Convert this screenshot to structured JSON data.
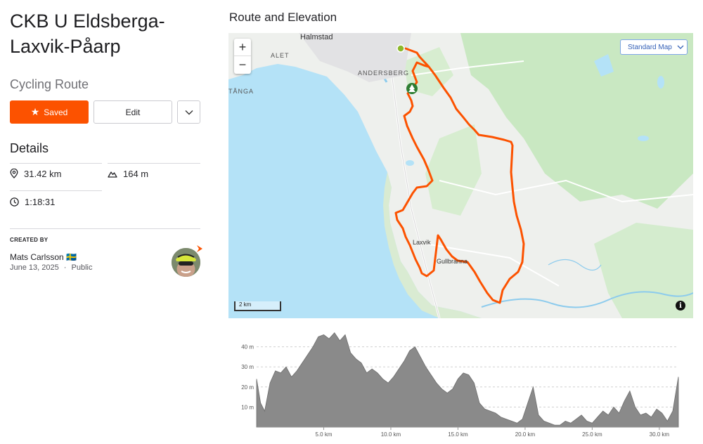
{
  "route": {
    "title": "CKB U Eldsberga-Laxvik-Påarp",
    "type": "Cycling Route"
  },
  "buttons": {
    "saved_label": "Saved",
    "edit_label": "Edit"
  },
  "details": {
    "heading": "Details",
    "distance": "31.42 km",
    "elevation_gain": "164 m",
    "duration": "1:18:31"
  },
  "creator": {
    "heading": "CREATED BY",
    "name": "Mats Carlsson 🇸🇪",
    "date": "June 13, 2025",
    "separator": "·",
    "visibility": "Public"
  },
  "map": {
    "section_title": "Route and Elevation",
    "zoom_in": "+",
    "zoom_out": "−",
    "style_select": "Standard Map",
    "scale_label": "2 km",
    "info": "i",
    "labels": {
      "city": "Halmstad",
      "alet": "ALET",
      "andersberg": "ANDERSBERG",
      "tanga": "TÅNGA",
      "laxvik": "Laxvik",
      "gullbranna": "Gullbranna"
    }
  },
  "colors": {
    "accent": "#fc5200",
    "route": "#fc5200",
    "water": "#b4e2f7",
    "land": "#eef0ed",
    "forest": "#c9e8c2",
    "start_marker": "#8cb82b",
    "poi_marker": "#2e7d32",
    "elevation_fill": "#8a8a8a"
  },
  "chart_data": {
    "type": "area",
    "title": "",
    "xlabel": "",
    "ylabel": "",
    "xlim": [
      0,
      31.42
    ],
    "ylim": [
      0,
      50
    ],
    "x_ticks": [
      "5.0 km",
      "10.0 km",
      "15.0 km",
      "20.0 km",
      "25.0 km",
      "30.0 km"
    ],
    "y_ticks": [
      "10 m",
      "20 m",
      "30 m",
      "40 m"
    ],
    "y_tick_values": [
      10,
      20,
      30,
      40
    ],
    "x_tick_values": [
      5,
      10,
      15,
      20,
      25,
      30
    ],
    "grid": true,
    "series": [
      {
        "x": [
          0,
          0.3,
          0.6,
          1.0,
          1.4,
          1.8,
          2.2,
          2.6,
          3.0,
          3.4,
          3.8,
          4.2,
          4.6,
          5.0,
          5.4,
          5.8,
          6.2,
          6.6,
          7.0,
          7.4,
          7.8,
          8.2,
          8.6,
          9.0,
          9.4,
          9.8,
          10.2,
          10.6,
          11.0,
          11.4,
          11.8,
          12.2,
          12.6,
          13.0,
          13.4,
          13.8,
          14.2,
          14.6,
          15.0,
          15.4,
          15.8,
          16.2,
          16.6,
          17.0,
          17.4,
          17.8,
          18.2,
          18.6,
          19.0,
          19.4,
          19.8,
          20.2,
          20.6,
          21.0,
          21.4,
          21.8,
          22.2,
          22.6,
          23.0,
          23.4,
          23.8,
          24.2,
          24.6,
          25.0,
          25.4,
          25.8,
          26.2,
          26.6,
          27.0,
          27.4,
          27.8,
          28.2,
          28.6,
          29.0,
          29.4,
          29.8,
          30.2,
          30.6,
          31.0,
          31.42
        ],
        "y": [
          24,
          12,
          8,
          22,
          28,
          27,
          30,
          25,
          28,
          32,
          36,
          40,
          45,
          46,
          44,
          47,
          43,
          46,
          37,
          34,
          32,
          27,
          29,
          27,
          24,
          22,
          25,
          29,
          33,
          38,
          40,
          35,
          30,
          26,
          22,
          19,
          17,
          19,
          24,
          27,
          26,
          22,
          12,
          9,
          8,
          7,
          5,
          4,
          3,
          2,
          4,
          12,
          20,
          6,
          3,
          2,
          1,
          1,
          3,
          2,
          4,
          6,
          3,
          2,
          5,
          8,
          6,
          10,
          7,
          13,
          18,
          10,
          6,
          7,
          5,
          9,
          7,
          3,
          8,
          25
        ]
      }
    ]
  }
}
